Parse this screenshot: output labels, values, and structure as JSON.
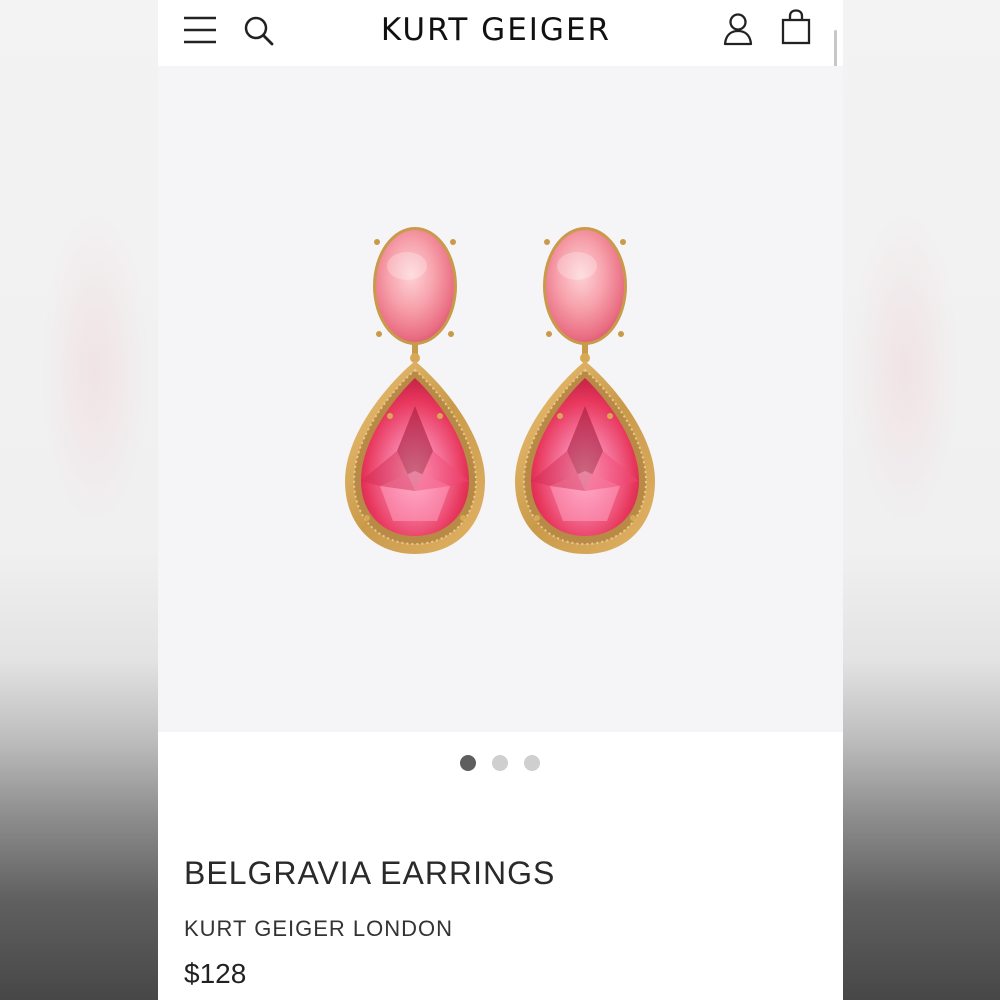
{
  "header": {
    "brand": "KURT GEIGER",
    "menu_icon": "hamburger-menu-icon",
    "search_icon": "search-icon",
    "account_icon": "user-account-icon",
    "bag_icon": "shopping-bag-icon"
  },
  "gallery": {
    "image": "pink-gem-drop-earrings-image",
    "slide_count": 3,
    "active_slide": 1
  },
  "product": {
    "name": "BELGRAVIA EARRINGS",
    "brand": "KURT GEIGER LONDON",
    "price": "$128"
  },
  "colors": {
    "stone_pink": "#f47b8f",
    "teardrop_red": "#e43d5f",
    "gold": "#c99a4a",
    "active_dot": "#5e5e5e",
    "inactive_dot": "#cfcfcf"
  }
}
